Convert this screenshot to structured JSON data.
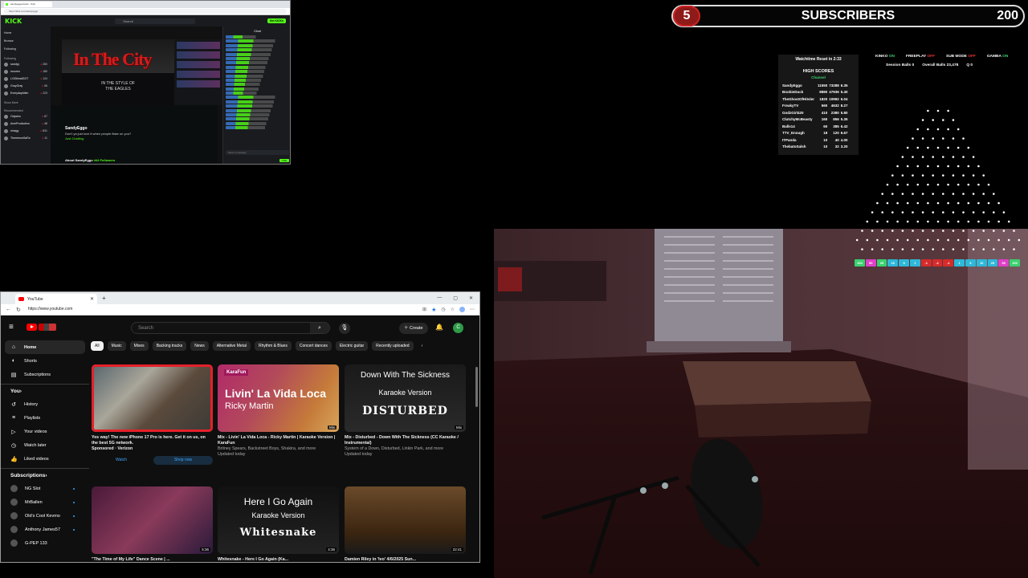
{
  "kick": {
    "tab_title": "sandyeggo/stuck - Kick",
    "url": "https://kick.com/sandyeggo",
    "logo": "KICK",
    "search_placeholder": "Search",
    "get_kicks": "Get KICKs",
    "nav": [
      "Home",
      "Browse",
      "Following"
    ],
    "following_label": "Following",
    "channels": [
      {
        "name": "sandyy",
        "sub": "Pokemon",
        "count": "260"
      },
      {
        "name": "mooreo",
        "sub": "Music & Stuff",
        "count": "180"
      },
      {
        "name": "LOOkinatGOT",
        "sub": "Fortnite",
        "count": "124"
      },
      {
        "name": "GrayGray",
        "sub": "Just Chatting",
        "count": "96"
      },
      {
        "name": "EverydayAllen",
        "sub": "Just Chatting",
        "count": "223"
      }
    ],
    "show_more": "Show More",
    "recommended_label": "Recommended",
    "recommended": [
      {
        "name": "Odysieo",
        "sub": "IRL",
        "count": "67"
      },
      {
        "name": "AverProduction",
        "sub": "Music",
        "count": "48"
      },
      {
        "name": "ninagy",
        "sub": "Slots",
        "count": "831"
      },
      {
        "name": "TheremonSaRo",
        "sub": "Music",
        "count": "11"
      }
    ],
    "video_title": "In The City",
    "video_sub_1": "IN THE STYLE OF",
    "video_sub_2": "THE EAGLES",
    "streamer": "SandyEggo",
    "stream_q": "Don't ya just love it when people flake on you?",
    "category": "Just Chatting",
    "about": "About SandyEggo",
    "followers": "444 Followers",
    "chat_title": "Chat",
    "chat_placeholder": "Send a message",
    "chat_send": "Chat"
  },
  "youtube": {
    "tab_title": "YouTube",
    "url": "https://www.youtube.com",
    "search_placeholder": "Search",
    "create_label": "Create",
    "avatar_letter": "C",
    "guide": [
      {
        "icon": "home-icon",
        "glyph": "⌂",
        "label": "Home",
        "active": true
      },
      {
        "icon": "shorts-icon",
        "glyph": "◐",
        "label": "Shorts"
      },
      {
        "icon": "subscriptions-icon",
        "glyph": "▤",
        "label": "Subscriptions"
      }
    ],
    "you_label": "You",
    "you_items": [
      {
        "icon": "history-icon",
        "glyph": "↺",
        "label": "History"
      },
      {
        "icon": "playlists-icon",
        "glyph": "≡",
        "label": "Playlists"
      },
      {
        "icon": "your-videos-icon",
        "glyph": "▷",
        "label": "Your videos"
      },
      {
        "icon": "watch-later-icon",
        "glyph": "◷",
        "label": "Watch later"
      },
      {
        "icon": "liked-icon",
        "glyph": "👍",
        "label": "Liked videos"
      }
    ],
    "subs_label": "Subscriptions",
    "subs": [
      "NG Slot",
      "MrBallen",
      "Old's Cool Kevmo",
      "Anthony James57",
      "G-PEP 133"
    ],
    "chips": [
      "All",
      "Music",
      "Mixes",
      "Backing tracks",
      "News",
      "Alternative Metal",
      "Rhythm & Blues",
      "Concert dances",
      "Electric guitar",
      "Recently uploaded"
    ],
    "videos": [
      {
        "title": "Yes way! The new iPhone 17 Pro is here. Get it on us, on the best 5G network.",
        "line2": "Sponsored · Verizon",
        "ad": true,
        "btn1": "Watch",
        "btn2": "Shop now"
      },
      {
        "title": "Mix - Livin' La Vida Loca - Ricky Martin | Karaoke Version | KaraFun",
        "line2": "Britney Spears, Backstreet Boys, Shakira, and more",
        "line3": "Updated today",
        "thumb_brand": "KaraFun",
        "thumb_title": "Livin' La Vida Loca",
        "thumb_artist": "Ricky Martin",
        "badge": "Mix"
      },
      {
        "title": "Mix - Disturbed - Down With The Sickness (CC Karaoke / Instrumental)",
        "line2": "System of a Down, Disturbed, Linkin Park, and more",
        "line3": "Updated today",
        "thumb_title": "Down With The Sickness",
        "thumb_sub": "Karaoke Version",
        "thumb_artist": "DISTURBED",
        "badge": "Mix"
      },
      {
        "title": "\"The Time of My Life\" Dance Scene | ...",
        "duration": "5:36"
      },
      {
        "title": "Whitesnake - Here I Go Again (Ka...",
        "duration": "4:36",
        "thumb_title": "Here I Go Again",
        "thumb_sub": "Karaoke Version",
        "thumb_artist": "Whitesnake"
      },
      {
        "title": "Damien Riley in 'Ivo' 4/6/2025 Sun...",
        "duration": "22:41"
      }
    ]
  },
  "overlay": {
    "sub_count": "5",
    "sub_label": "SUBSCRIBERS",
    "sub_goal": "200",
    "watchtime": "Watchtime Reset in 2:33",
    "hs_title": "HIGH SCORES",
    "hs_channel": "Channel",
    "scores": [
      [
        "SandyEggo",
        "11550",
        "73288",
        "6.35"
      ],
      [
        "BoobieDuck",
        "8880",
        "47936",
        "5.40"
      ],
      [
        "TheGhostOfHitsler",
        "1820",
        "10992",
        "6.04"
      ],
      [
        "FreakyTV",
        "560",
        "4632",
        "8.27"
      ],
      [
        "GodzGirl420",
        "410",
        "2380",
        "5.80"
      ],
      [
        "ClutchyMcBeasty",
        "160",
        "856",
        "5.35"
      ],
      [
        "Balls14",
        "60",
        "385",
        "6.42"
      ],
      [
        "TTV_Enough",
        "18",
        "120",
        "6.67"
      ],
      [
        "ITPanda",
        "10",
        "40",
        "4.00"
      ],
      [
        "ThebatoSalsh",
        "10",
        "32",
        "3.20"
      ]
    ],
    "flags": [
      {
        "name": "KINKO",
        "state": "ON",
        "on": true
      },
      {
        "name": "FREEPLAY",
        "state": "OFF",
        "on": false
      },
      {
        "name": "SUB MODE",
        "state": "OFF",
        "on": false
      },
      {
        "name": "GAMBA",
        "state": "ON",
        "on": true
      }
    ],
    "session_balls_label": "Session Balls",
    "session_balls": "0",
    "overall_balls_label": "Overall Balls",
    "overall_balls": "23,478",
    "q_label": "Q",
    "q_value": "0",
    "bins": [
      "100",
      "50",
      "25",
      "10",
      "5",
      "1",
      "-1",
      "-2",
      "-1",
      "1",
      "5",
      "10",
      "25",
      "50",
      "100"
    ],
    "bin_colors": [
      "#3bd16f",
      "#e040c8",
      "#3bd16f",
      "#2fb8d8",
      "#2fb8d8",
      "#2fb8d8",
      "#d62b2b",
      "#d62b2b",
      "#d62b2b",
      "#2fb8d8",
      "#2fb8d8",
      "#2fb8d8",
      "#2fb8d8",
      "#e040c8",
      "#3bd16f"
    ]
  }
}
